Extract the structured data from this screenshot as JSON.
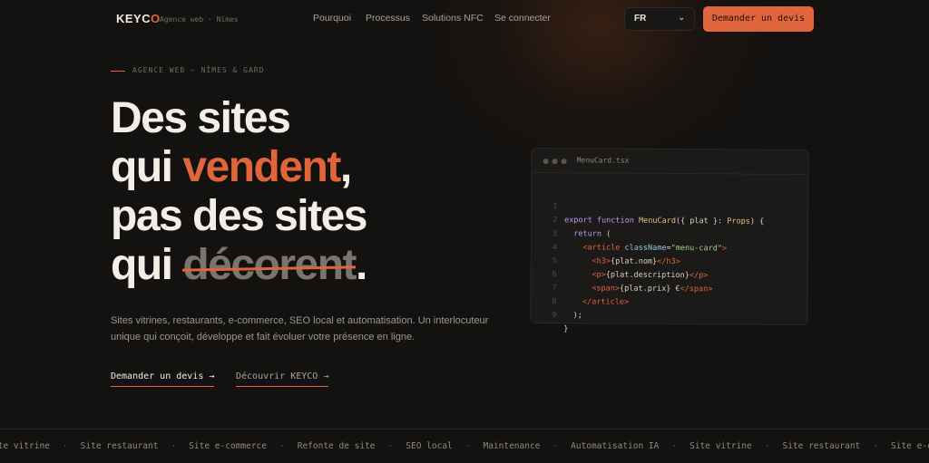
{
  "brand": {
    "logo_prefix": "KEYC",
    "logo_accent": "O",
    "tagline": "Agence web · Nîmes"
  },
  "nav": {
    "items": [
      "Pourquoi",
      "Processus",
      "Solutions NFC",
      "Se connecter"
    ]
  },
  "language_select": {
    "value": "FR"
  },
  "header_cta": {
    "label": "Demander un devis"
  },
  "hero": {
    "eyebrow": "AGENCE WEB — NÎMES & GARD",
    "title_line1": "Des sites",
    "title_line2_a": "qui ",
    "title_line2_highlight": "vendent",
    "title_line2_b": ",",
    "title_line3": "pas des sites",
    "title_line4_a": "qui ",
    "title_line4_strike": "décorent",
    "title_line4_b": ".",
    "description": "Sites vitrines, restaurants, e-commerce, SEO local et automatisation. Un interlocuteur unique qui conçoit, développe et fait évoluer votre présence en ligne.",
    "primary_link": "Demander un devis →",
    "secondary_link": "Découvrir KEYCO →"
  },
  "code_card": {
    "filename": "MenuCard.tsx",
    "line_numbers": [
      "1",
      "2",
      "3",
      "4",
      "5",
      "6",
      "7",
      "8",
      "9"
    ]
  },
  "ticker": {
    "items": [
      "ite vitrine",
      "Site restaurant",
      "Site e-commerce",
      "Refonte de site",
      "SEO local",
      "Maintenance",
      "Automatisation IA",
      "Site vitrine",
      "Site restaurant",
      "Site e-commer"
    ],
    "separator": "·"
  },
  "colors": {
    "background": "#141210",
    "accent": "#e0653a",
    "text": "#ece6dc",
    "muted": "#9d978e"
  }
}
